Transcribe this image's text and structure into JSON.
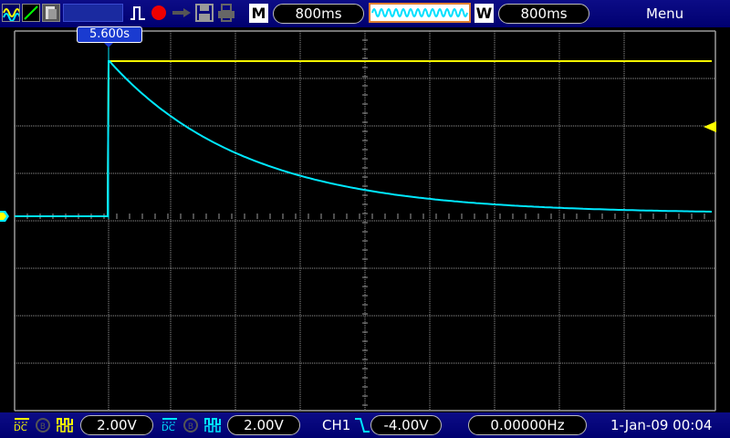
{
  "toolbar": {
    "timebase_mode": "M",
    "timebase_value": "800ms",
    "window_mode": "W",
    "window_value": "800ms",
    "menu_label": "Menu"
  },
  "trigger_marker": {
    "label": "5.600s"
  },
  "channels": [
    {
      "coupling": "DC",
      "scale": "2.00V",
      "color": "#ffff00"
    },
    {
      "coupling": "DC",
      "scale": "2.00V",
      "color": "#00e8ff"
    }
  ],
  "trigger": {
    "source": "CH1",
    "level": "-4.00V",
    "frequency": "0.00000Hz"
  },
  "datetime": "1-Jan-09 00:04",
  "colors": {
    "ch1": "#ffff00",
    "ch2": "#00e8ff",
    "bar": "#000080",
    "grid": "#9a9a9a"
  },
  "icons": [
    "math-icon",
    "ref-icon",
    "cursor-icon",
    "record-icon",
    "probe-icon",
    "save-icon",
    "print-icon",
    "window-waveform-icon"
  ]
}
